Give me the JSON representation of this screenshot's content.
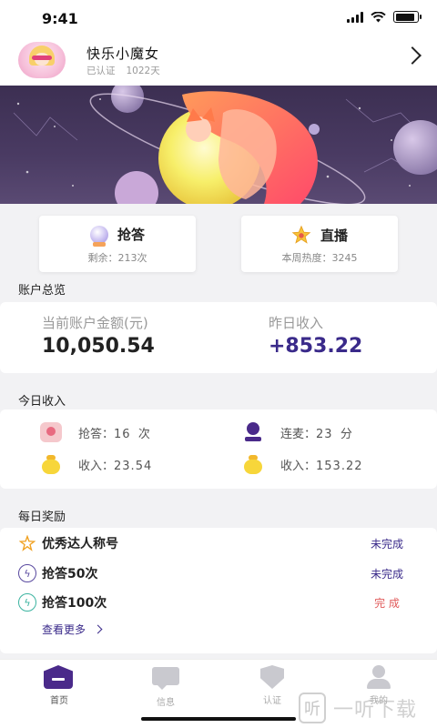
{
  "status_bar": {
    "time": "9:41",
    "battery_level": 0.9
  },
  "profile": {
    "name": "快乐小魔女",
    "verified": "已认证",
    "days": "1022天"
  },
  "actions": [
    {
      "label": "抢答",
      "sub": "剩余：213次",
      "icon": "crystal-ball-icon"
    },
    {
      "label": "直播",
      "sub": "本周热度：3245",
      "icon": "star-icon"
    }
  ],
  "account": {
    "section_title": "账户总览",
    "balance_label": "当前账户金额(元)",
    "balance_value": "10,050.54",
    "yesterday_label": "昨日收入",
    "yesterday_value": "+853.22",
    "accent": "#3a2a8a"
  },
  "today": {
    "section_title": "今日收入",
    "items": [
      {
        "label": "抢答：",
        "value": "16",
        "unit": "次",
        "icon": "gift-box-icon"
      },
      {
        "label": "连麦：",
        "value": "23",
        "unit": "分",
        "icon": "microphone-icon"
      },
      {
        "label": "收入：",
        "value": "23.54",
        "icon": "money-bag-icon"
      },
      {
        "label": "收入：",
        "value": "153.22",
        "icon": "money-bag-icon"
      }
    ]
  },
  "rewards": {
    "section_title": "每日奖励",
    "items": [
      {
        "name": "优秀达人称号",
        "status": "未完成",
        "status_color": "#3a2a8a",
        "icon": "sparkle-star-icon"
      },
      {
        "name": "抢答50次",
        "status": "未完成",
        "status_color": "#3a2a8a",
        "icon": "lightning-bubble-icon"
      },
      {
        "name": "抢答100次",
        "status": "完  成",
        "status_color": "#e05a5a",
        "icon": "lightning-bubble-icon"
      }
    ],
    "see_more": "查看更多"
  },
  "tabs": [
    {
      "label": "首页",
      "icon": "home-icon",
      "active": true
    },
    {
      "label": "信息",
      "icon": "message-icon",
      "active": false
    },
    {
      "label": "认证",
      "icon": "shield-icon",
      "active": false
    },
    {
      "label": "我的",
      "icon": "user-icon",
      "active": false
    }
  ],
  "watermark": {
    "logo": "听",
    "text": "一听下载"
  }
}
